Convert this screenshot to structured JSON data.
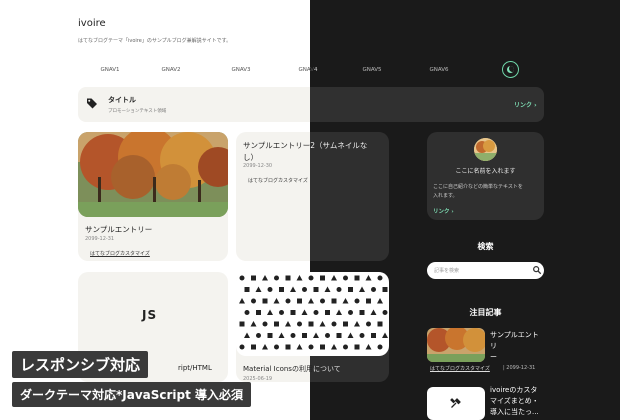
{
  "site": {
    "title": "ivoire",
    "description": "はてなブログテーマ「ivoire」のサンプルブログ兼解説サイトです。"
  },
  "nav": [
    "GNAV1",
    "GNAV2",
    "GNAV3",
    "GNAV4",
    "GNAV5",
    "GNAV6"
  ],
  "banner": {
    "title": "タイトル",
    "subtitle": "プロモーションテキスト領域",
    "link": "リンク ›"
  },
  "cards": [
    {
      "title": "サンプルエントリー",
      "date": "2099-12-31",
      "tag": "はてなブログカスタマイズ"
    },
    {
      "title_lines": [
        "サンプルエントリー2（サムネイルな",
        "し）"
      ],
      "date": "2099-12-30",
      "tag": "はてなブログカスタマイズ"
    },
    {
      "thumb_text": "JS",
      "title_fragment": "ript/HTML"
    },
    {
      "title": "Material Iconsの利用について",
      "date": "2025-06-19"
    }
  ],
  "profile": {
    "name": "ここに名前を入れます",
    "description_lines": [
      "ここに自己紹介などの簡単なテキストを",
      "入れます。"
    ],
    "link": "リンク ›"
  },
  "search": {
    "heading": "検索",
    "placeholder": "記事を検索"
  },
  "featured": {
    "heading": "注目記事",
    "items": [
      {
        "title_lines": [
          "サンプルエントリ",
          "ー"
        ],
        "tag": "はてなブログカスタマイズ",
        "date": "2099-12-31"
      },
      {
        "title_lines": [
          "ivoireのカスタ",
          "マイズまとめ・",
          "導入に当たっ..."
        ]
      }
    ]
  },
  "overlay": {
    "line1": "レスポンシブ対応",
    "line2": "ダークテーマ対応*JavaScript 導入必須"
  },
  "colors": {
    "accent": "#7fe0b6",
    "light_bg": "#ffffff",
    "dark_bg": "#1a1a1a",
    "card_light": "#f4f3ef",
    "card_dark": "#2f2f2f"
  },
  "icons": [
    "tag-icon",
    "moon-icon",
    "search-icon",
    "tools-icon"
  ]
}
